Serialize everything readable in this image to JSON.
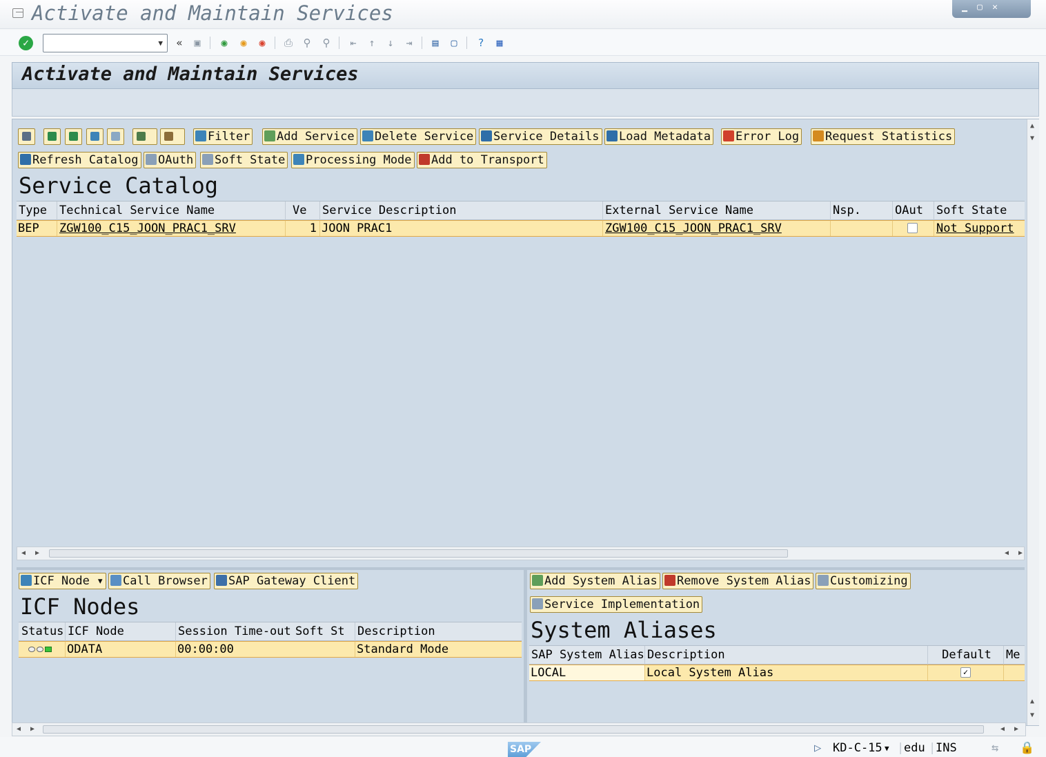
{
  "window": {
    "title": "Activate and Maintain Services"
  },
  "page_title": "Activate and Maintain Services",
  "toolbar_main": {
    "filter": "Filter",
    "add_service": "Add Service",
    "delete_service": "Delete Service",
    "service_details": "Service Details",
    "load_metadata": "Load Metadata",
    "error_log": "Error Log",
    "request_statistics": "Request Statistics",
    "refresh_catalog": "Refresh Catalog",
    "oauth": "OAuth",
    "soft_state": "Soft State",
    "processing_mode": "Processing Mode",
    "add_to_transport": "Add to Transport"
  },
  "service_catalog": {
    "title": "Service Catalog",
    "columns": [
      "Type",
      "Technical Service Name",
      "Ve",
      "Service Description",
      "External Service Name",
      "Nsp.",
      "OAut",
      "Soft State"
    ],
    "rows": [
      {
        "type": "BEP",
        "technical_name": "ZGW100_C15_JOON_PRAC1_SRV",
        "version": "1",
        "description": "JOON PRAC1",
        "external_name": "ZGW100_C15_JOON_PRAC1_SRV",
        "namespace": "",
        "oauth": false,
        "soft_state": "Not Support"
      }
    ]
  },
  "icf": {
    "buttons": {
      "icf_node": "ICF Node",
      "call_browser": "Call Browser",
      "gateway_client": "SAP Gateway Client"
    },
    "title": "ICF Nodes",
    "columns": [
      "Status",
      "ICF Node",
      "Session Time-out",
      "Soft St",
      "Description"
    ],
    "rows": [
      {
        "node": "ODATA",
        "timeout": "00:00:00",
        "description": "Standard Mode"
      }
    ]
  },
  "aliases": {
    "buttons": {
      "add": "Add System Alias",
      "remove": "Remove System Alias",
      "customizing": "Customizing",
      "service_impl": "Service Implementation"
    },
    "title": "System Aliases",
    "columns": [
      "SAP System Alias",
      "Description",
      "Default",
      "Me"
    ],
    "rows": [
      {
        "alias": "LOCAL",
        "description": "Local System Alias",
        "default": true
      }
    ]
  },
  "status_bar": {
    "system": "KD-C-15",
    "client": "edu",
    "mode": "INS",
    "logo": "SAP"
  },
  "colors": {
    "button_bg": "#fbf0c4",
    "selected_row": "#fce9ac",
    "panel_bg": "#cfdbe7",
    "ok_green": "#2aa745"
  }
}
